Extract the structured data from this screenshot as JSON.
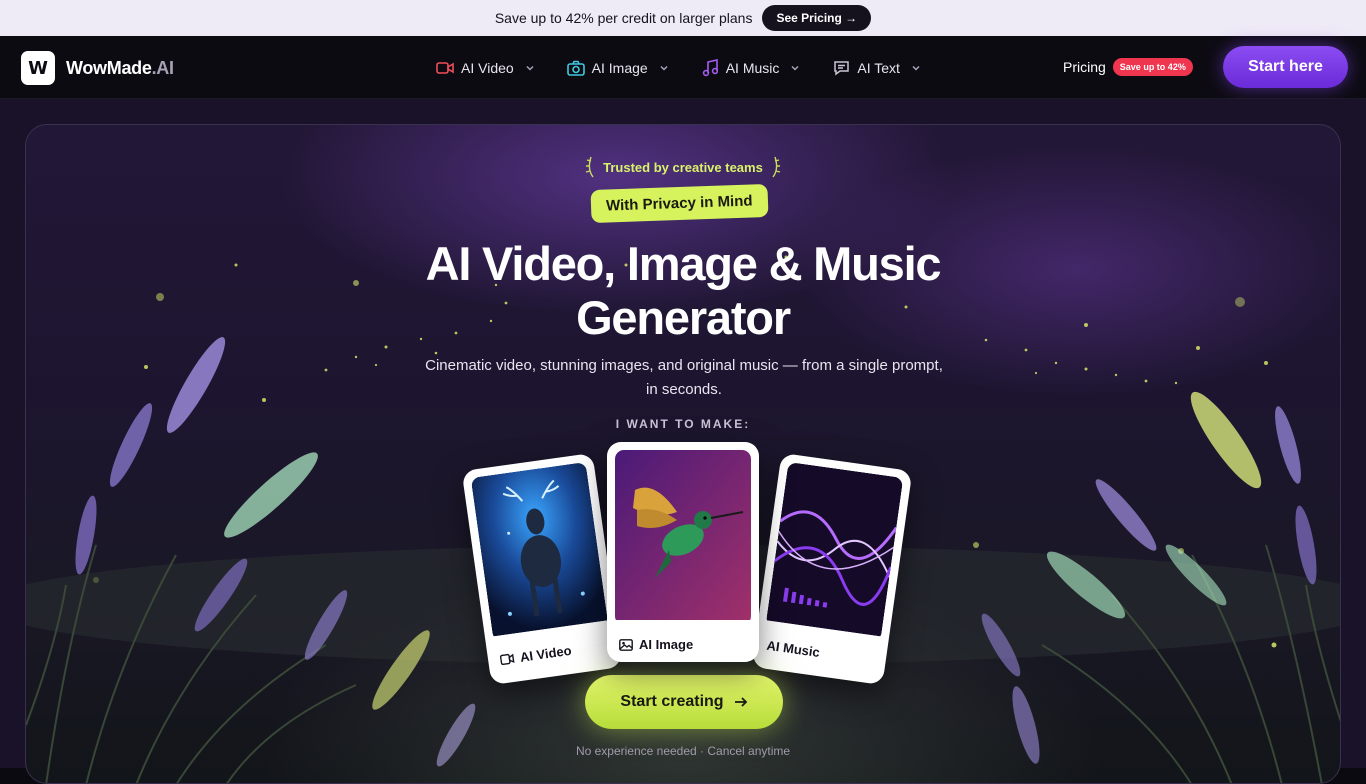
{
  "promo": {
    "text": "Save up to 42% per credit on larger plans",
    "button": "See Pricing →"
  },
  "header": {
    "logo_mark": "W",
    "logo_name": "WowMade",
    "logo_suffix": ".AI",
    "nav": [
      {
        "label": "AI Video",
        "icon": "video-icon",
        "color": "#f04d5a"
      },
      {
        "label": "AI Image",
        "icon": "camera-icon",
        "color": "#3fc9e0"
      },
      {
        "label": "AI Music",
        "icon": "music-note-icon",
        "color": "#a45cf0"
      },
      {
        "label": "AI Text",
        "icon": "chat-icon",
        "color": "#c9c4d6"
      }
    ],
    "pricing_label": "Pricing",
    "pricing_badge": "Save up to 42%",
    "start_button": "Start here"
  },
  "hero": {
    "trusted": "Trusted by creative teams",
    "pill": "With Privacy in Mind",
    "headline_line1": "AI Video, Image & Music",
    "headline_line2": "Generator",
    "subtitle": "Cinematic video, stunning images, and original music — from a single prompt, in seconds.",
    "want_label": "I WANT TO MAKE:",
    "cards": [
      {
        "label": "AI Video",
        "icon": "video-icon"
      },
      {
        "label": "AI Image",
        "icon": "image-icon"
      },
      {
        "label": "AI Music",
        "icon": "music-icon"
      }
    ],
    "cta": "Start creating",
    "note": "No experience needed · Cancel anytime"
  },
  "colors": {
    "accent_lime": "#d6f25c",
    "accent_purple": "#7a3ae6",
    "badge_red": "#f0364f"
  }
}
